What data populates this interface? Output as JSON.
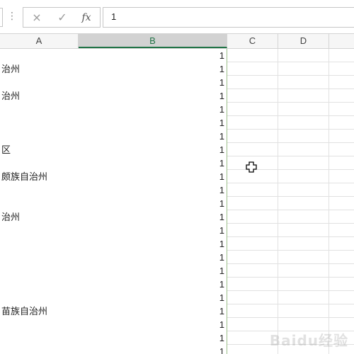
{
  "formula_bar": {
    "dots": "⋮",
    "cancel_icon": "×",
    "enter_icon": "✓",
    "fx_label": "fx",
    "value": "1"
  },
  "columns": [
    "A",
    "B",
    "C",
    "D"
  ],
  "rows": [
    {
      "a": "",
      "b": "1"
    },
    {
      "a": "治州",
      "b": "1"
    },
    {
      "a": "",
      "b": "1"
    },
    {
      "a": "治州",
      "b": "1"
    },
    {
      "a": "",
      "b": "1"
    },
    {
      "a": "",
      "b": "1"
    },
    {
      "a": "",
      "b": "1"
    },
    {
      "a": "区",
      "b": "1"
    },
    {
      "a": "",
      "b": "1"
    },
    {
      "a": "颇族自治州",
      "b": "1"
    },
    {
      "a": "",
      "b": "1"
    },
    {
      "a": "",
      "b": "1"
    },
    {
      "a": "治州",
      "b": "1"
    },
    {
      "a": "",
      "b": "1"
    },
    {
      "a": "",
      "b": "1"
    },
    {
      "a": "",
      "b": "1"
    },
    {
      "a": "",
      "b": "1"
    },
    {
      "a": "",
      "b": "1"
    },
    {
      "a": "",
      "b": "1"
    },
    {
      "a": "苗族自治州",
      "b": "1"
    },
    {
      "a": "",
      "b": "1"
    },
    {
      "a": "",
      "b": "1"
    },
    {
      "a": "",
      "b": "1"
    },
    {
      "a": "",
      "b": "1"
    }
  ],
  "watermark": "Baidu经验",
  "accent_color": "#217346"
}
